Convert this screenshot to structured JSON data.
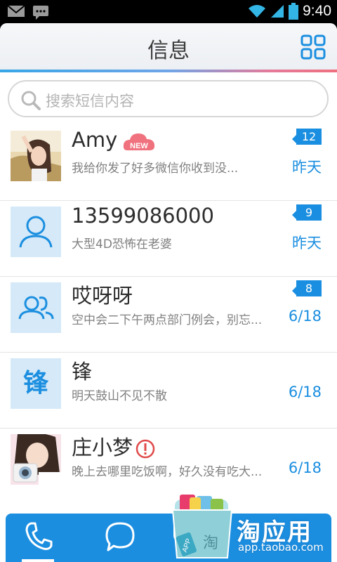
{
  "status_bar": {
    "time": "9:40"
  },
  "header": {
    "title": "信息"
  },
  "search": {
    "placeholder": "搜索短信内容"
  },
  "conversations": [
    {
      "name": "Amy",
      "tag": "NEW",
      "preview": "我给你发了好多微信你收到没...",
      "badge": "12",
      "date": "昨天",
      "avatar": "photo-girl"
    },
    {
      "name": "13599086000",
      "preview": "大型4D恐怖在老婆",
      "badge": "9",
      "date": "昨天",
      "avatar": "person-icon"
    },
    {
      "name": "哎呀呀",
      "preview": "空中会二下午两点部门例会，别忘...",
      "badge": "8",
      "date": "6/18",
      "avatar": "group-icon"
    },
    {
      "name": "锋",
      "avatar_char": "锋",
      "preview": "明天鼓山不见不散",
      "date": "6/18",
      "avatar": "char-avatar"
    },
    {
      "name": "庄小梦",
      "preview": "晚上去哪里吃饭啊，好久没有吃大...",
      "date": "6/18",
      "avatar": "photo-girl-camera",
      "alert": true
    }
  ],
  "watermark": {
    "brand": "淘应用",
    "url": "app.taobao.com",
    "app_label": "APP",
    "bag_char": "淘"
  },
  "colors": {
    "accent": "#1a8ee0",
    "new_tag": "#f0727e",
    "alert": "#e04a4a"
  }
}
